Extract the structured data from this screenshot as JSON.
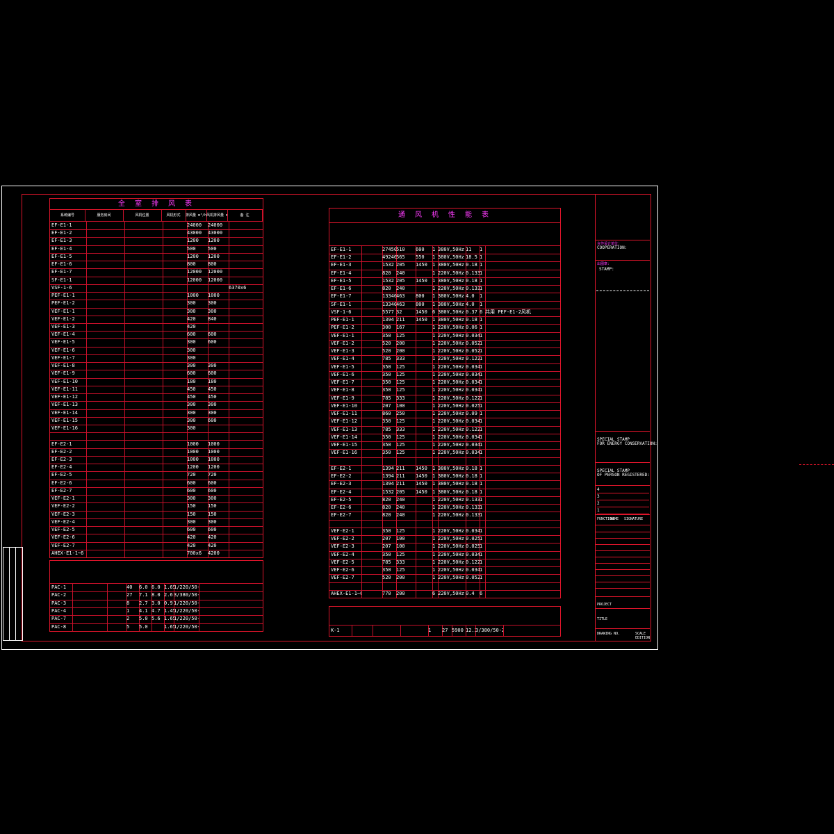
{
  "left_table": {
    "title": "全 室 排 风 表",
    "headers": [
      "系统编号",
      "服务房间",
      "风机位置",
      "风机形式",
      "排风量 m³/h",
      "风机排风量 m³/h",
      "备 注"
    ],
    "rows": [
      [
        "EF-E1-1",
        "",
        "",
        "",
        "24000",
        "24000",
        ""
      ],
      [
        "EF-E1-2",
        "",
        "",
        "",
        "43000",
        "43000",
        ""
      ],
      [
        "EF-E1-3",
        "",
        "",
        "",
        "1200",
        "1200",
        ""
      ],
      [
        "EF-E1-4",
        "",
        "",
        "",
        "500",
        "500",
        ""
      ],
      [
        "EF-E1-5",
        "",
        "",
        "",
        "1200",
        "1200",
        ""
      ],
      [
        "EF-E1-6",
        "",
        "",
        "",
        "800",
        "800",
        ""
      ],
      [
        "EF-E1-7",
        "",
        "",
        "",
        "12000",
        "12000",
        ""
      ],
      [
        "SF-E1-1",
        "",
        "",
        "",
        "12000",
        "12000",
        ""
      ],
      [
        "VSF-1-6",
        "",
        "",
        "",
        "",
        "",
        "6370x6"
      ],
      [
        "PEF-E1-1",
        "",
        "",
        "",
        "1000",
        "1000",
        ""
      ],
      [
        "PEF-E1-2",
        "",
        "",
        "",
        "300",
        "300",
        ""
      ],
      [
        "VEF-E1-1",
        "",
        "",
        "",
        "300",
        "300",
        ""
      ],
      [
        "VEF-E1-2",
        "",
        "",
        "",
        "420",
        "840",
        ""
      ],
      [
        "VEF-E1-3",
        "",
        "",
        "",
        "420",
        "",
        ""
      ],
      [
        "VEF-E1-4",
        "",
        "",
        "",
        "600",
        "600",
        ""
      ],
      [
        "VEF-E1-5",
        "",
        "",
        "",
        "300",
        "600",
        ""
      ],
      [
        "VEF-E1-6",
        "",
        "",
        "",
        "300",
        "",
        ""
      ],
      [
        "VEF-E1-7",
        "",
        "",
        "",
        "300",
        "",
        ""
      ],
      [
        "VEF-E1-8",
        "",
        "",
        "",
        "300",
        "300",
        ""
      ],
      [
        "VEF-E1-9",
        "",
        "",
        "",
        "600",
        "600",
        ""
      ],
      [
        "VEF-E1-10",
        "",
        "",
        "",
        "180",
        "180",
        ""
      ],
      [
        "VEF-E1-11",
        "",
        "",
        "",
        "450",
        "450",
        ""
      ],
      [
        "VEF-E1-12",
        "",
        "",
        "",
        "450",
        "450",
        ""
      ],
      [
        "VEF-E1-13",
        "",
        "",
        "",
        "300",
        "300",
        ""
      ],
      [
        "VEF-E1-14",
        "",
        "",
        "",
        "300",
        "300",
        ""
      ],
      [
        "VEF-E1-15",
        "",
        "",
        "",
        "300",
        "600",
        ""
      ],
      [
        "VEF-E1-16",
        "",
        "",
        "",
        "300",
        "",
        ""
      ],
      [
        "",
        "",
        "",
        "",
        "",
        "",
        ""
      ],
      [
        "EF-E2-1",
        "",
        "",
        "",
        "1000",
        "1000",
        ""
      ],
      [
        "EF-E2-2",
        "",
        "",
        "",
        "1000",
        "1000",
        ""
      ],
      [
        "EF-E2-3",
        "",
        "",
        "",
        "1000",
        "1000",
        ""
      ],
      [
        "EF-E2-4",
        "",
        "",
        "",
        "1200",
        "1200",
        ""
      ],
      [
        "EF-E2-5",
        "",
        "",
        "",
        "720",
        "720",
        ""
      ],
      [
        "EF-E2-6",
        "",
        "",
        "",
        "600",
        "600",
        ""
      ],
      [
        "EF-E2-7",
        "",
        "",
        "",
        "600",
        "600",
        ""
      ],
      [
        "VEF-E2-1",
        "",
        "",
        "",
        "300",
        "300",
        ""
      ],
      [
        "VEF-E2-2",
        "",
        "",
        "",
        "150",
        "150",
        ""
      ],
      [
        "VEF-E2-3",
        "",
        "",
        "",
        "150",
        "150",
        ""
      ],
      [
        "VEF-E2-4",
        "",
        "",
        "",
        "300",
        "300",
        ""
      ],
      [
        "VEF-E2-5",
        "",
        "",
        "",
        "600",
        "600",
        ""
      ],
      [
        "VEF-E2-6",
        "",
        "",
        "",
        "420",
        "420",
        ""
      ],
      [
        "VEF-E2-7",
        "",
        "",
        "",
        "420",
        "420",
        ""
      ],
      [
        "AHEX-E1-1~6",
        "",
        "",
        "",
        "700x6",
        "4200",
        ""
      ]
    ]
  },
  "pac_table": {
    "rows": [
      [
        "PAC-1",
        "",
        "",
        "40",
        "6.0",
        "6.0",
        "1.65",
        "1/220/50-22",
        ""
      ],
      [
        "PAC-2",
        "",
        "",
        "27",
        "7.1",
        "8.0",
        "2.6",
        "3/380/50-22",
        ""
      ],
      [
        "PAC-3",
        "",
        "",
        "8",
        "2.7",
        "3.0",
        "0.9",
        "1/220/50-22",
        ""
      ],
      [
        "PAC-4",
        "",
        "",
        "1",
        "4.1",
        "4.7",
        "1.45",
        "1/220/50-22",
        ""
      ],
      [
        "PAC-7",
        "",
        "",
        "2",
        "5.0",
        "5.6",
        "1.65",
        "1/220/50-22",
        ""
      ],
      [
        "PAC-8",
        "",
        "",
        "5",
        "5.0",
        "",
        "1.65",
        "1/220/50-22",
        ""
      ]
    ]
  },
  "right_table": {
    "title": "通 风 机 性 能 表",
    "rows": [
      [
        "EF-E1-1",
        "27450",
        "510",
        "",
        "600",
        "1",
        "380V,50Hz",
        "11",
        "1"
      ],
      [
        "EF-E1-2",
        "49240",
        "565",
        "",
        "550",
        "1",
        "380V,50Hz",
        "18.5",
        "1"
      ],
      [
        "EF-E1-3",
        "1532",
        "205",
        "",
        "1450",
        "1",
        "380V,50Hz",
        "0.18",
        "1"
      ],
      [
        "EF-E1-4",
        "820",
        "240",
        "",
        "",
        "1",
        "220V,50Hz",
        "0.133",
        "1"
      ],
      [
        "EF-E1-5",
        "1532",
        "205",
        "",
        "1450",
        "1",
        "380V,50Hz",
        "0.18",
        "1"
      ],
      [
        "EF-E1-6",
        "820",
        "240",
        "",
        "",
        "1",
        "220V,50Hz",
        "0.133",
        "1"
      ],
      [
        "EF-E1-7",
        "13340",
        "463",
        "",
        "800",
        "1",
        "380V,50Hz",
        "4.0",
        "1"
      ],
      [
        "SF-E1-1",
        "13340",
        "463",
        "",
        "800",
        "1",
        "380V,50Hz",
        "4.0",
        "1"
      ],
      [
        "VSF-1-6",
        "5577",
        "32",
        "",
        "1450",
        "6",
        "380V,50Hz",
        "0.37",
        "6"
      ],
      [
        "PEF-E1-1",
        "1394",
        "211",
        "",
        "1450",
        "1",
        "380V,50Hz",
        "0.18",
        "1"
      ],
      [
        "PEF-E1-2",
        "300",
        "167",
        "",
        "",
        "1",
        "220V,50Hz",
        "0.06",
        "1"
      ],
      [
        "VEF-E1-1",
        "350",
        "125",
        "",
        "",
        "1",
        "220V,50Hz",
        "0.034",
        "1"
      ],
      [
        "VEF-E1-2",
        "520",
        "200",
        "",
        "",
        "1",
        "220V,50Hz",
        "0.052",
        "1"
      ],
      [
        "VEF-E1-3",
        "520",
        "200",
        "",
        "",
        "1",
        "220V,50Hz",
        "0.052",
        "1"
      ],
      [
        "VEF-E1-4",
        "785",
        "333",
        "",
        "",
        "1",
        "220V,50Hz",
        "0.122",
        "1"
      ],
      [
        "VEF-E1-5",
        "350",
        "125",
        "",
        "",
        "1",
        "220V,50Hz",
        "0.034",
        "1"
      ],
      [
        "VEF-E1-6",
        "350",
        "125",
        "",
        "",
        "1",
        "220V,50Hz",
        "0.034",
        "1"
      ],
      [
        "VEF-E1-7",
        "350",
        "125",
        "",
        "",
        "1",
        "220V,50Hz",
        "0.034",
        "1"
      ],
      [
        "VEF-E1-8",
        "350",
        "125",
        "",
        "",
        "1",
        "220V,50Hz",
        "0.034",
        "1"
      ],
      [
        "VEF-E1-9",
        "785",
        "333",
        "",
        "",
        "1",
        "220V,50Hz",
        "0.122",
        "1"
      ],
      [
        "VEF-E1-10",
        "207",
        "100",
        "",
        "",
        "1",
        "220V,50Hz",
        "0.025",
        "1"
      ],
      [
        "VEF-E1-11",
        "860",
        "250",
        "",
        "",
        "1",
        "220V,50Hz",
        "0.09",
        "1"
      ],
      [
        "VEF-E1-12",
        "350",
        "125",
        "",
        "",
        "1",
        "220V,50Hz",
        "0.034",
        "1"
      ],
      [
        "VEF-E1-13",
        "785",
        "333",
        "",
        "",
        "1",
        "220V,50Hz",
        "0.122",
        "1"
      ],
      [
        "VEF-E1-14",
        "350",
        "125",
        "",
        "",
        "1",
        "220V,50Hz",
        "0.034",
        "1"
      ],
      [
        "VEF-E1-15",
        "350",
        "125",
        "",
        "",
        "1",
        "220V,50Hz",
        "0.034",
        "1"
      ],
      [
        "VEF-E1-16",
        "350",
        "125",
        "",
        "",
        "1",
        "220V,50Hz",
        "0.034",
        "1"
      ],
      [
        "",
        "",
        "",
        "",
        "",
        "",
        "",
        "",
        ""
      ],
      [
        "EF-E2-1",
        "1394",
        "211",
        "",
        "1450",
        "1",
        "380V,50Hz",
        "0.18",
        "1"
      ],
      [
        "EF-E2-2",
        "1394",
        "211",
        "",
        "1450",
        "1",
        "380V,50Hz",
        "0.18",
        "1"
      ],
      [
        "EF-E2-3",
        "1394",
        "211",
        "",
        "1450",
        "1",
        "380V,50Hz",
        "0.18",
        "1"
      ],
      [
        "EF-E2-4",
        "1532",
        "205",
        "",
        "1450",
        "1",
        "380V,50Hz",
        "0.18",
        "1"
      ],
      [
        "EF-E2-5",
        "820",
        "240",
        "",
        "",
        "1",
        "220V,50Hz",
        "0.133",
        "1"
      ],
      [
        "EF-E2-6",
        "820",
        "240",
        "",
        "",
        "1",
        "220V,50Hz",
        "0.133",
        "1"
      ],
      [
        "EF-E2-7",
        "820",
        "240",
        "",
        "",
        "1",
        "220V,50Hz",
        "0.133",
        "1"
      ],
      [
        "",
        "",
        "",
        "",
        "",
        "",
        "",
        "",
        ""
      ],
      [
        "VEF-E2-1",
        "350",
        "125",
        "",
        "",
        "1",
        "220V,50Hz",
        "0.034",
        "1"
      ],
      [
        "VEF-E2-2",
        "207",
        "100",
        "",
        "",
        "1",
        "220V,50Hz",
        "0.025",
        "1"
      ],
      [
        "VEF-E2-3",
        "207",
        "100",
        "",
        "",
        "1",
        "220V,50Hz",
        "0.025",
        "1"
      ],
      [
        "VEF-E2-4",
        "350",
        "125",
        "",
        "",
        "1",
        "220V,50Hz",
        "0.034",
        "1"
      ],
      [
        "VEF-E2-5",
        "785",
        "333",
        "",
        "",
        "1",
        "220V,50Hz",
        "0.122",
        "1"
      ],
      [
        "VEF-E2-6",
        "350",
        "125",
        "",
        "",
        "1",
        "220V,50Hz",
        "0.034",
        "1"
      ],
      [
        "VEF-E2-7",
        "520",
        "200",
        "",
        "",
        "1",
        "220V,50Hz",
        "0.052",
        "1"
      ],
      [
        "",
        "",
        "",
        "",
        "",
        "",
        "",
        "",
        ""
      ],
      [
        "AHEX-E1-1~6",
        "770",
        "200",
        "",
        "",
        "6",
        "220V,50Hz",
        "0.4",
        "6"
      ]
    ],
    "remark_vsf": "共用 PEF-E1-2风机"
  },
  "k_table": {
    "row": [
      "K-1",
      "",
      "",
      "",
      "1",
      "27",
      "5900",
      "12.3",
      "3/380/50-22",
      ""
    ]
  },
  "title_block": {
    "cooperation": "COOPERATION:",
    "stamp": "STAMP:",
    "special_stamp_1": "SPECIAL STAMP",
    "special_stamp_1b": "FOR ENERGY CONSERVATION:",
    "special_stamp_2": "SPECIAL STAMP",
    "special_stamp_2b": "OF PERSON REGISTERED:",
    "revisions": [
      "4",
      "3",
      "2",
      "1"
    ],
    "function": "FUNCTION",
    "name": "NAME",
    "signature": "SIGNATURE",
    "project": "PROJECT",
    "title": "TITLE",
    "drawing_no": "DRAWING NO.",
    "scale": "SCALE",
    "edition": "EDITION"
  }
}
